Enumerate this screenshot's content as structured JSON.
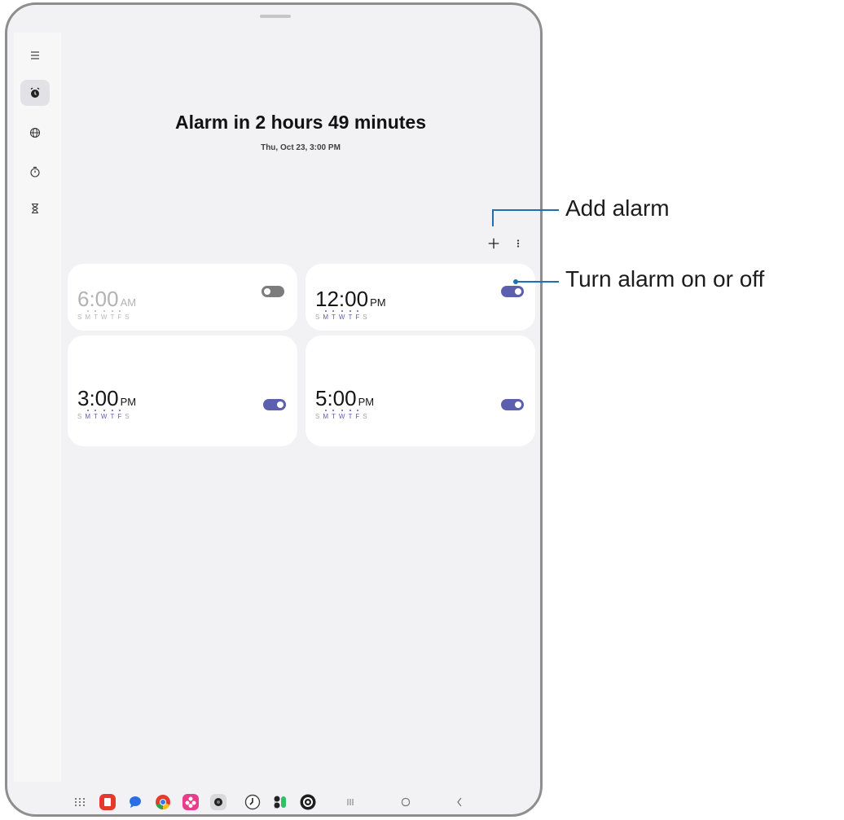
{
  "header": {
    "title": "Alarm in 2 hours 49 minutes",
    "subtitle": "Thu, Oct 23, 3:00 PM"
  },
  "rail": {
    "items": [
      {
        "icon": "menu-icon",
        "active": false
      },
      {
        "icon": "alarm-icon",
        "active": true
      },
      {
        "icon": "world-clock-icon",
        "active": false
      },
      {
        "icon": "stopwatch-icon",
        "active": false
      },
      {
        "icon": "timer-icon",
        "active": false
      }
    ]
  },
  "toolbar": {
    "add_icon": "plus-icon",
    "more_icon": "more-vert-icon"
  },
  "alarms": [
    {
      "time": "6:00",
      "ampm": "AM",
      "enabled": false,
      "days": [
        "S",
        "M",
        "T",
        "W",
        "T",
        "F",
        "S"
      ],
      "active_days": [
        false,
        true,
        true,
        true,
        true,
        true,
        false
      ]
    },
    {
      "time": "12:00",
      "ampm": "PM",
      "enabled": true,
      "days": [
        "S",
        "M",
        "T",
        "W",
        "T",
        "F",
        "S"
      ],
      "active_days": [
        false,
        true,
        true,
        true,
        true,
        true,
        false
      ]
    },
    {
      "time": "3:00",
      "ampm": "PM",
      "enabled": true,
      "days": [
        "S",
        "M",
        "T",
        "W",
        "T",
        "F",
        "S"
      ],
      "active_days": [
        false,
        true,
        true,
        true,
        true,
        true,
        false
      ]
    },
    {
      "time": "5:00",
      "ampm": "PM",
      "enabled": true,
      "days": [
        "S",
        "M",
        "T",
        "W",
        "T",
        "F",
        "S"
      ],
      "active_days": [
        false,
        true,
        true,
        true,
        true,
        true,
        false
      ]
    }
  ],
  "dock": {
    "apps": [
      "apps-grid-icon",
      "notes-app-icon",
      "messages-app-icon",
      "chrome-app-icon",
      "galaxy-store-app-icon",
      "camera-app-icon",
      "clock-app-icon",
      "quick-share-app-icon",
      "settings-app-icon"
    ],
    "nav": [
      "recents-nav-icon",
      "home-nav-icon",
      "back-nav-icon"
    ]
  },
  "callouts": {
    "add_alarm": "Add alarm",
    "toggle": "Turn alarm on or off"
  },
  "colors": {
    "accent": "#5c5fae",
    "screen_bg": "#f2f2f4",
    "card_bg": "#ffffff",
    "callout_line": "#1f6fb5"
  }
}
